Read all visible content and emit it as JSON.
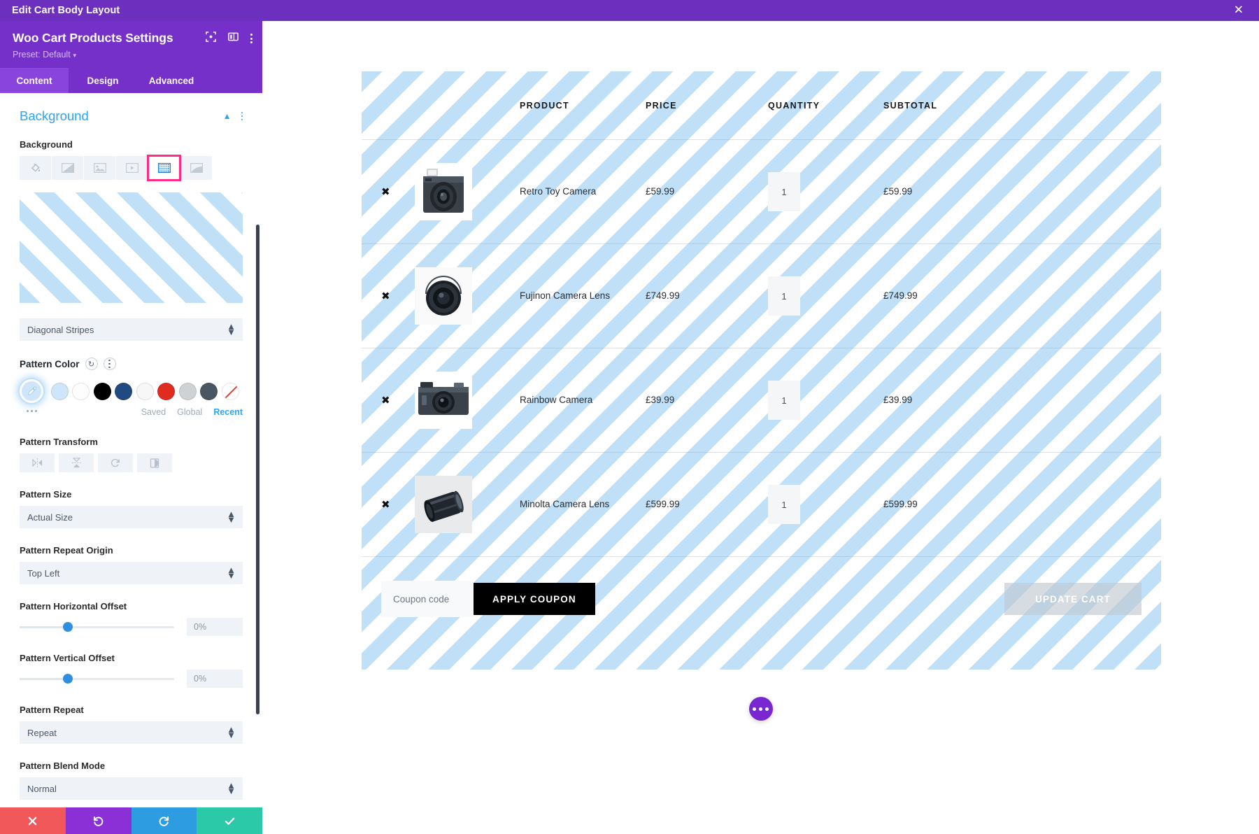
{
  "topbar": {
    "title": "Edit Cart Body Layout",
    "close_icon": "close-icon"
  },
  "panel": {
    "title": "Woo Cart Products Settings",
    "preset_label": "Preset: Default",
    "header_icons": [
      "focus-icon",
      "layout-columns-icon",
      "more-vertical-icon"
    ],
    "tabs": [
      {
        "label": "Content",
        "active": true
      },
      {
        "label": "Design",
        "active": false
      },
      {
        "label": "Advanced",
        "active": false
      }
    ],
    "section": {
      "title": "Background",
      "collapse_icon": "chevron-up-icon",
      "menu_icon": "more-vertical-icon"
    },
    "background": {
      "label": "Background",
      "types": [
        {
          "name": "color-fill-icon",
          "selected": false
        },
        {
          "name": "gradient-icon",
          "selected": false
        },
        {
          "name": "image-icon",
          "selected": false
        },
        {
          "name": "video-icon",
          "selected": false
        },
        {
          "name": "pattern-icon",
          "selected": true
        },
        {
          "name": "mask-icon",
          "selected": false
        }
      ],
      "selected_highlight_color": "#ff2b84"
    },
    "pattern_select": {
      "value": "Diagonal Stripes"
    },
    "pattern_color": {
      "label": "Pattern Color",
      "reset_icon": "reset-icon",
      "menu_icon": "more-vertical-icon",
      "picker_icon": "eyedropper-icon",
      "swatches": [
        {
          "name": "swatch-light-blue",
          "color": "#cfe6fa"
        },
        {
          "name": "swatch-white",
          "color": "#fdfdfd"
        },
        {
          "name": "swatch-black",
          "color": "#000000"
        },
        {
          "name": "swatch-navy",
          "color": "#204a80"
        },
        {
          "name": "swatch-offwhite",
          "color": "#f7f7f7"
        },
        {
          "name": "swatch-red",
          "color": "#e02b20"
        },
        {
          "name": "swatch-light-gray",
          "color": "#cfd2d4"
        },
        {
          "name": "swatch-slate",
          "color": "#4a5662"
        },
        {
          "name": "swatch-none",
          "color": "#ffffff"
        }
      ],
      "more_icon": "more-horizontal-icon",
      "tabs": [
        {
          "label": "Saved",
          "active": false
        },
        {
          "label": "Global",
          "active": false
        },
        {
          "label": "Recent",
          "active": true
        }
      ]
    },
    "pattern_transform": {
      "label": "Pattern Transform",
      "buttons": [
        {
          "name": "flip-horizontal-icon"
        },
        {
          "name": "flip-vertical-icon"
        },
        {
          "name": "rotate-icon"
        },
        {
          "name": "invert-icon"
        }
      ]
    },
    "pattern_size": {
      "label": "Pattern Size",
      "value": "Actual Size"
    },
    "pattern_repeat_origin": {
      "label": "Pattern Repeat Origin",
      "value": "Top Left"
    },
    "pattern_horizontal_offset": {
      "label": "Pattern Horizontal Offset",
      "value": "0%"
    },
    "pattern_vertical_offset": {
      "label": "Pattern Vertical Offset",
      "value": "0%"
    },
    "pattern_repeat": {
      "label": "Pattern Repeat",
      "value": "Repeat"
    },
    "pattern_blend_mode": {
      "label": "Pattern Blend Mode",
      "value": "Normal"
    },
    "actions": [
      {
        "name": "cancel-button",
        "icon": "close-icon",
        "color": "#f0585a"
      },
      {
        "name": "undo-button",
        "icon": "undo-icon",
        "color": "#8b2fd6"
      },
      {
        "name": "redo-button",
        "icon": "redo-icon",
        "color": "#2e9ce0"
      },
      {
        "name": "save-button",
        "icon": "check-icon",
        "color": "#2cc9a8"
      }
    ]
  },
  "cart": {
    "pattern_color": "#bfe0f7",
    "columns": [
      "",
      "",
      "PRODUCT",
      "PRICE",
      "QUANTITY",
      "SUBTOTAL"
    ],
    "headers": {
      "product": "PRODUCT",
      "price": "PRICE",
      "quantity": "QUANTITY",
      "subtotal": "SUBTOTAL"
    },
    "rows": [
      {
        "remove": "✖",
        "image": "retro-toy-camera-thumbnail",
        "product": "Retro Toy Camera",
        "price": "£59.99",
        "quantity": "1",
        "subtotal": "£59.99"
      },
      {
        "remove": "✖",
        "image": "fujinon-camera-lens-thumbnail",
        "product": "Fujinon Camera Lens",
        "price": "£749.99",
        "quantity": "1",
        "subtotal": "£749.99"
      },
      {
        "remove": "✖",
        "image": "rainbow-camera-thumbnail",
        "product": "Rainbow Camera",
        "price": "£39.99",
        "quantity": "1",
        "subtotal": "£39.99"
      },
      {
        "remove": "✖",
        "image": "minolta-camera-lens-thumbnail",
        "product": "Minolta Camera Lens",
        "price": "£599.99",
        "quantity": "1",
        "subtotal": "£599.99"
      }
    ],
    "coupon_placeholder": "Coupon code",
    "apply_coupon_label": "APPLY COUPON",
    "update_cart_label": "UPDATE CART"
  },
  "fab": {
    "name": "page-settings-fab",
    "color": "#7928d1"
  }
}
